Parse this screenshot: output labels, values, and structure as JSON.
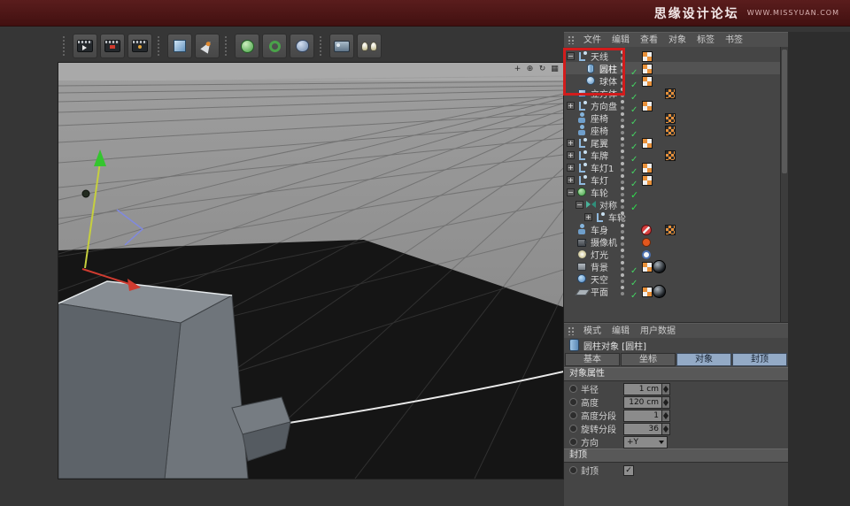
{
  "banner": {
    "site_name": "思缘设计论坛",
    "site_url": "WWW.MISSYUAN.COM"
  },
  "toolbar": {
    "groups": [
      [
        {
          "name": "render-view",
          "icon": "clap1"
        },
        {
          "name": "render-to-picture-viewer",
          "icon": "clap2"
        },
        {
          "name": "render-settings",
          "icon": "clap3"
        }
      ],
      [
        {
          "name": "add-cube",
          "icon": "cube"
        },
        {
          "name": "freehand-spline",
          "icon": "pen"
        }
      ],
      [
        {
          "name": "subdivision-surface",
          "icon": "subdiv"
        },
        {
          "name": "array-generator",
          "icon": "array"
        },
        {
          "name": "metaball",
          "icon": "meta"
        }
      ],
      [
        {
          "name": "add-camera",
          "icon": "cam"
        },
        {
          "name": "add-light",
          "icon": "lights"
        }
      ]
    ]
  },
  "viewport": {
    "controls": [
      {
        "name": "pan-view-icon",
        "glyph": "+"
      },
      {
        "name": "zoom-view-icon",
        "glyph": "⊕"
      },
      {
        "name": "rotate-view-icon",
        "glyph": "↻"
      },
      {
        "name": "toggle-view-icon",
        "glyph": "▦"
      }
    ]
  },
  "object_manager": {
    "menu": [
      "文件",
      "编辑",
      "查看",
      "对象",
      "标签",
      "书签"
    ],
    "menu_keys": [
      "file",
      "edit",
      "view",
      "objects",
      "tags",
      "bookmarks"
    ],
    "rows": [
      {
        "label": "天线",
        "depth": 0,
        "expand": "minus",
        "icon": "null",
        "badges": [
          "dots",
          "tex"
        ],
        "selected": false
      },
      {
        "label": "圆柱",
        "depth": 1,
        "expand": "none",
        "icon": "cylinder",
        "badges": [
          "dots",
          "check",
          "tex"
        ],
        "selected": true
      },
      {
        "label": "球体",
        "depth": 1,
        "expand": "none",
        "icon": "sphere",
        "badges": [
          "dots",
          "check",
          "tex"
        ],
        "selected": false
      },
      {
        "label": "立方体",
        "depth": 0,
        "expand": "none",
        "icon": "cube",
        "badges": [
          "dots",
          "check",
          "checker2"
        ],
        "selected": false
      },
      {
        "label": "方向盘",
        "depth": 0,
        "expand": "plus",
        "icon": "null",
        "badges": [
          "dots",
          "check",
          "tex"
        ],
        "selected": false
      },
      {
        "label": "座椅",
        "depth": 0,
        "expand": "none",
        "icon": "figure",
        "badges": [
          "dots",
          "check",
          "checker2"
        ],
        "selected": false
      },
      {
        "label": "座椅",
        "depth": 0,
        "expand": "none",
        "icon": "figure",
        "badges": [
          "dots",
          "check",
          "checker2"
        ],
        "selected": false
      },
      {
        "label": "尾翼",
        "depth": 0,
        "expand": "plus",
        "icon": "null",
        "badges": [
          "dots",
          "check",
          "tex"
        ],
        "selected": false
      },
      {
        "label": "车牌",
        "depth": 0,
        "expand": "plus",
        "icon": "null",
        "badges": [
          "dots",
          "check",
          "checker2"
        ],
        "selected": false
      },
      {
        "label": "车灯1",
        "depth": 0,
        "expand": "plus",
        "icon": "null",
        "badges": [
          "dots",
          "check",
          "tex"
        ],
        "selected": false
      },
      {
        "label": "车灯",
        "depth": 0,
        "expand": "plus",
        "icon": "null",
        "badges": [
          "dots",
          "check",
          "tex"
        ],
        "selected": false
      },
      {
        "label": "车轮",
        "depth": 0,
        "expand": "minus",
        "icon": "sweep",
        "badges": [
          "dots",
          "bigcheck"
        ],
        "selected": false
      },
      {
        "label": "对称",
        "depth": 1,
        "expand": "minus",
        "icon": "symmetry",
        "badges": [
          "dots",
          "bigcheck"
        ],
        "selected": false
      },
      {
        "label": "车轮",
        "depth": 2,
        "expand": "plus",
        "icon": "null",
        "badges": [
          "dots"
        ],
        "selected": false
      },
      {
        "label": "车身",
        "depth": 0,
        "expand": "none",
        "icon": "figure",
        "badges": [
          "dots",
          "noentry",
          "checker2"
        ],
        "selected": false
      },
      {
        "label": "摄像机",
        "depth": 0,
        "expand": "none",
        "icon": "camera",
        "badges": [
          "dots",
          "camdot"
        ],
        "selected": false
      },
      {
        "label": "灯光",
        "depth": 0,
        "expand": "none",
        "icon": "light",
        "badges": [
          "dots",
          "lightdot"
        ],
        "selected": false
      },
      {
        "label": "背景",
        "depth": 0,
        "expand": "none",
        "icon": "background",
        "badges": [
          "dots",
          "check",
          "tex",
          "spherethumb"
        ],
        "selected": false
      },
      {
        "label": "天空",
        "depth": 0,
        "expand": "none",
        "icon": "sky",
        "badges": [
          "dots",
          "check"
        ],
        "selected": false
      },
      {
        "label": "平面",
        "depth": 0,
        "expand": "none",
        "icon": "plane",
        "badges": [
          "dots",
          "check",
          "tex",
          "spherethumb"
        ],
        "selected": false
      }
    ]
  },
  "attribute_manager": {
    "menu": [
      "模式",
      "编辑",
      "用户数据"
    ],
    "menu_keys": [
      "mode",
      "edit",
      "user-data"
    ],
    "title": "圆柱对象 [圆柱]",
    "tabs": [
      {
        "key": "basic",
        "label": "基本",
        "active": false
      },
      {
        "key": "coordinates",
        "label": "坐标",
        "active": false
      },
      {
        "key": "object",
        "label": "对象",
        "active": true
      },
      {
        "key": "caps",
        "label": "封顶",
        "active": true
      }
    ],
    "sections": [
      {
        "heading": "对象属性",
        "fields": [
          {
            "key": "radius",
            "label": "半径",
            "value": "1 cm",
            "type": "stepper"
          },
          {
            "key": "height",
            "label": "高度",
            "value": "120 cm",
            "type": "stepper"
          },
          {
            "key": "height-segments",
            "label": "高度分段",
            "value": "1",
            "type": "stepper"
          },
          {
            "key": "rotation-segments",
            "label": "旋转分段",
            "value": "36",
            "type": "stepper"
          },
          {
            "key": "orientation",
            "label": "方向",
            "value": "+Y",
            "type": "dropdown"
          }
        ]
      },
      {
        "heading": "封顶",
        "fields": [
          {
            "key": "caps",
            "label": "封顶",
            "type": "checkbox",
            "checked": true
          }
        ]
      }
    ]
  },
  "annotation": {
    "highlight_color": "#d21c1c"
  }
}
